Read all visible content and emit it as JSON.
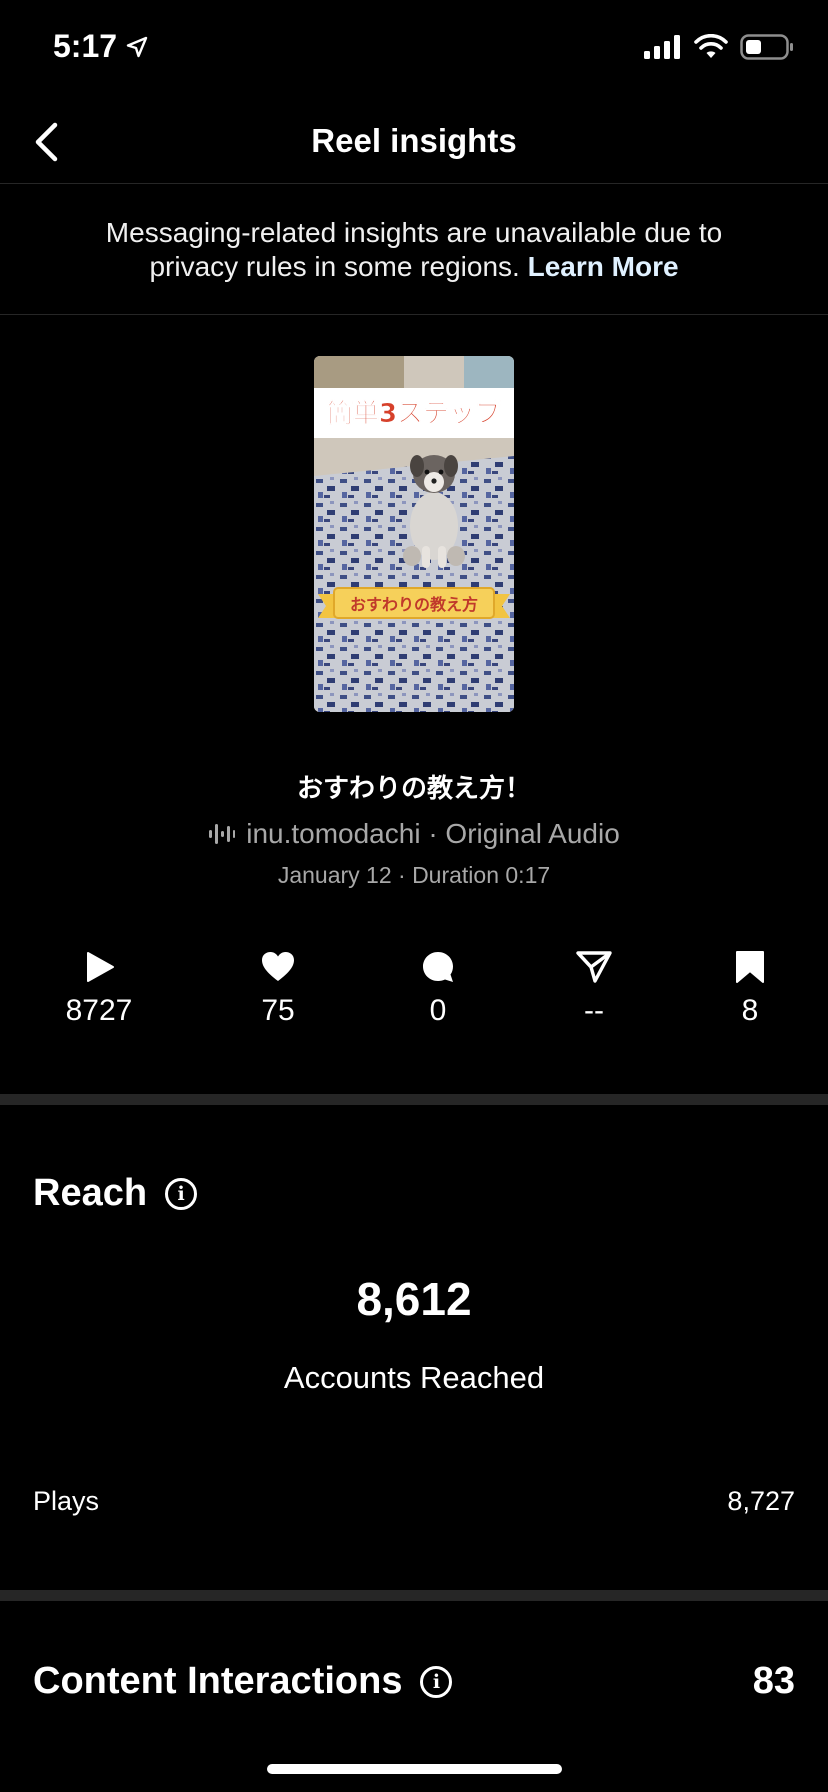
{
  "status_bar": {
    "time": "5:17"
  },
  "header": {
    "title": "Reel insights"
  },
  "notice": {
    "text": "Messaging-related insights are unavailable due to privacy rules in some regions.",
    "link_label": "Learn More"
  },
  "reel": {
    "thumbnail_top_caption": "簡単3ステップ",
    "thumbnail_bottom_caption": "おすわりの教え方",
    "title": "おすわりの教え方！",
    "audio": "inu.tomodachi · Original Audio",
    "meta": "January 12 · Duration 0:17"
  },
  "stats": [
    {
      "icon": "play-icon",
      "value": "8727"
    },
    {
      "icon": "heart-icon",
      "value": "75"
    },
    {
      "icon": "comment-icon",
      "value": "0"
    },
    {
      "icon": "share-icon",
      "value": "--"
    },
    {
      "icon": "bookmark-icon",
      "value": "8"
    }
  ],
  "reach": {
    "heading": "Reach",
    "accounts_reached": "8,612",
    "accounts_reached_label": "Accounts Reached",
    "plays_label": "Plays",
    "plays_value": "8,727"
  },
  "content_interactions": {
    "heading": "Content Interactions",
    "value": "83"
  },
  "colors": {
    "background": "#000000",
    "divider": "#262626",
    "muted_text": "#a8a8a8",
    "link": "#e0f1ff"
  }
}
